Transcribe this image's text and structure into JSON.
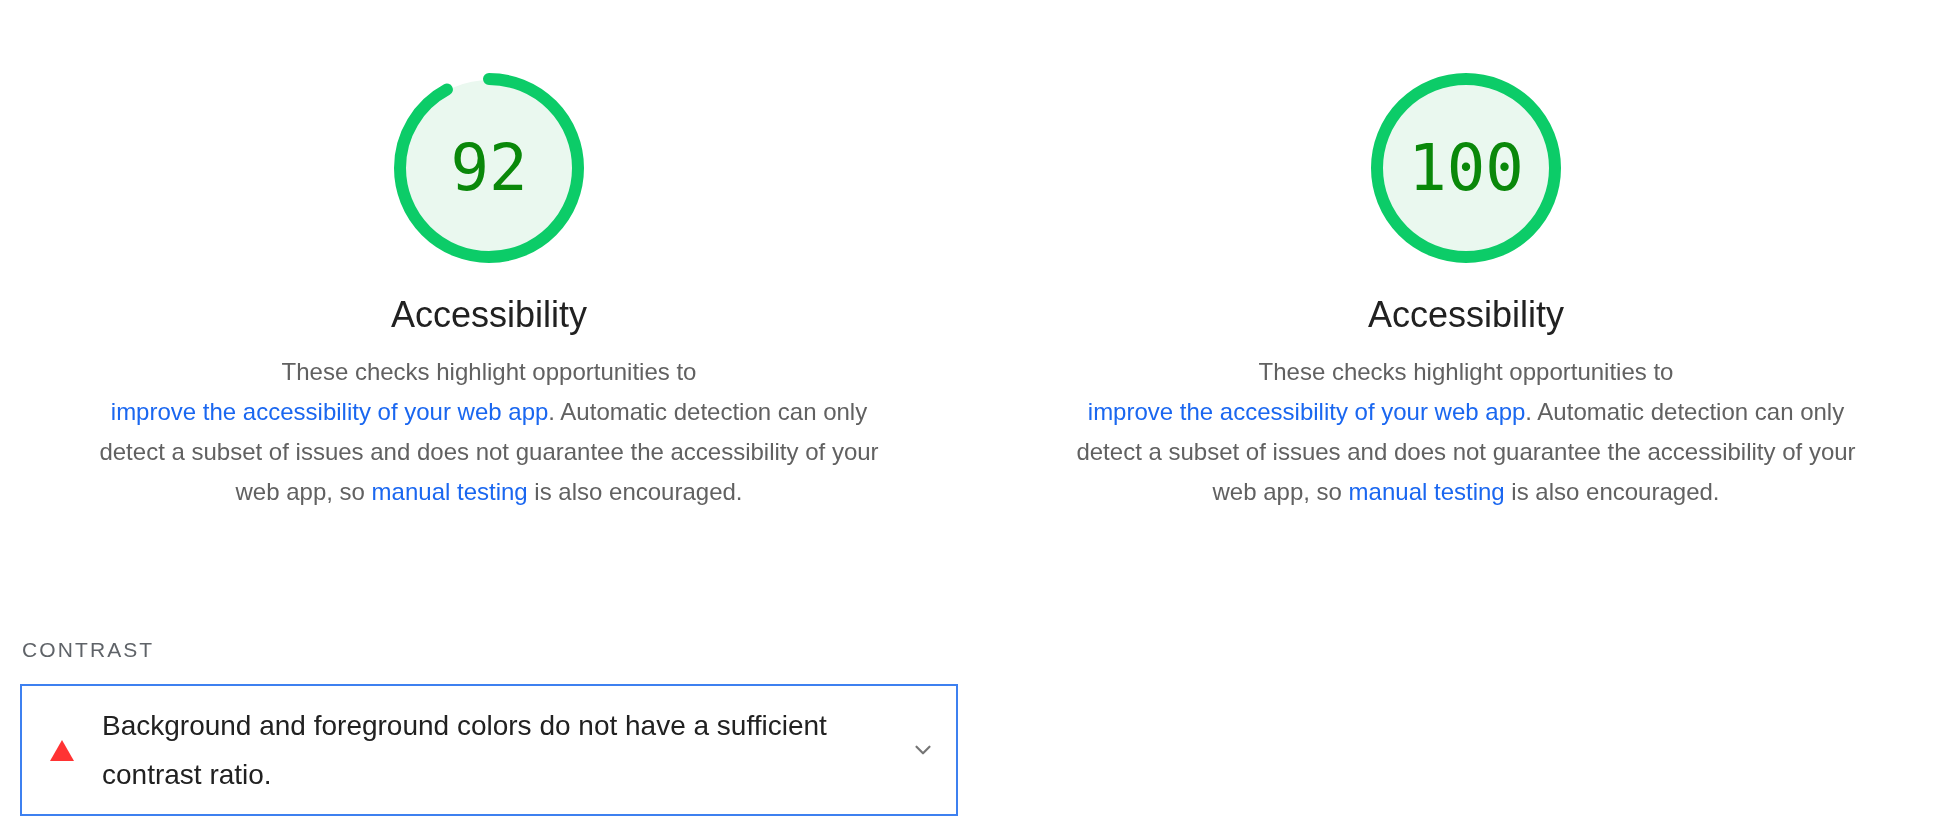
{
  "gauges": [
    {
      "score": "92",
      "level": 0.92,
      "title": "Accessibility",
      "description": [
        {
          "kind": "text",
          "text": "These checks highlight opportunities to "
        },
        {
          "kind": "link",
          "text": "improve the accessibility of your web app"
        },
        {
          "kind": "text",
          "text": ". Automatic detection can only detect a subset of issues and does not guarantee the accessibility of your web app, so "
        },
        {
          "kind": "link",
          "text": "manual testing"
        },
        {
          "kind": "text",
          "text": " is also encouraged."
        }
      ]
    },
    {
      "score": "100",
      "level": 1,
      "title": "Accessibility",
      "description": [
        {
          "kind": "text",
          "text": "These checks highlight opportunities to "
        },
        {
          "kind": "link",
          "text": "improve the accessibility of your web app"
        },
        {
          "kind": "text",
          "text": ". Automatic detection can only detect a subset of issues and does not guarantee the accessibility of your web app, so "
        },
        {
          "kind": "link",
          "text": "manual testing"
        },
        {
          "kind": "text",
          "text": " is also encouraged."
        }
      ]
    }
  ],
  "section": {
    "heading": "CONTRAST",
    "audits": [
      {
        "kind": "fail",
        "title": "Background and foreground colors do not have a sufficient contrast ratio.",
        "expanded": false
      }
    ]
  }
}
